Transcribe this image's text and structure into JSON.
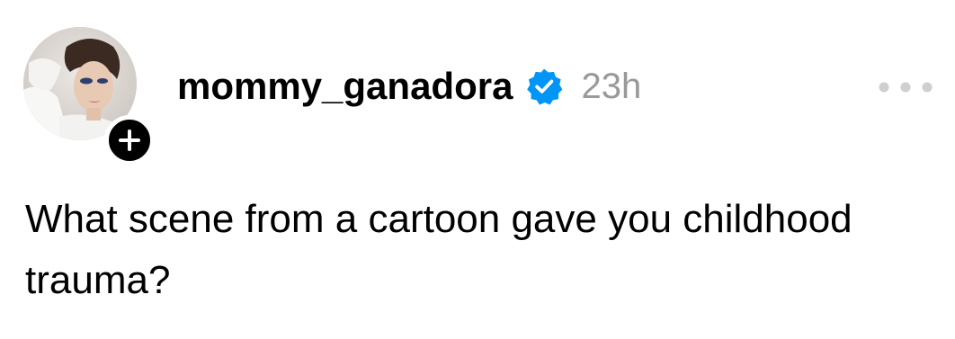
{
  "post": {
    "author": {
      "username": "mommy_ganadora",
      "verified": true,
      "avatar_icon": "profile-photo",
      "follow_icon": "plus-icon"
    },
    "timestamp": "23h",
    "more_icon": "more-horizontal-icon",
    "text": "What scene from a cartoon gave you childhood trauma?"
  },
  "colors": {
    "verified_blue": "#0095f6",
    "timestamp_gray": "#999999",
    "more_gray": "#cfcfcf",
    "text": "#000000"
  }
}
